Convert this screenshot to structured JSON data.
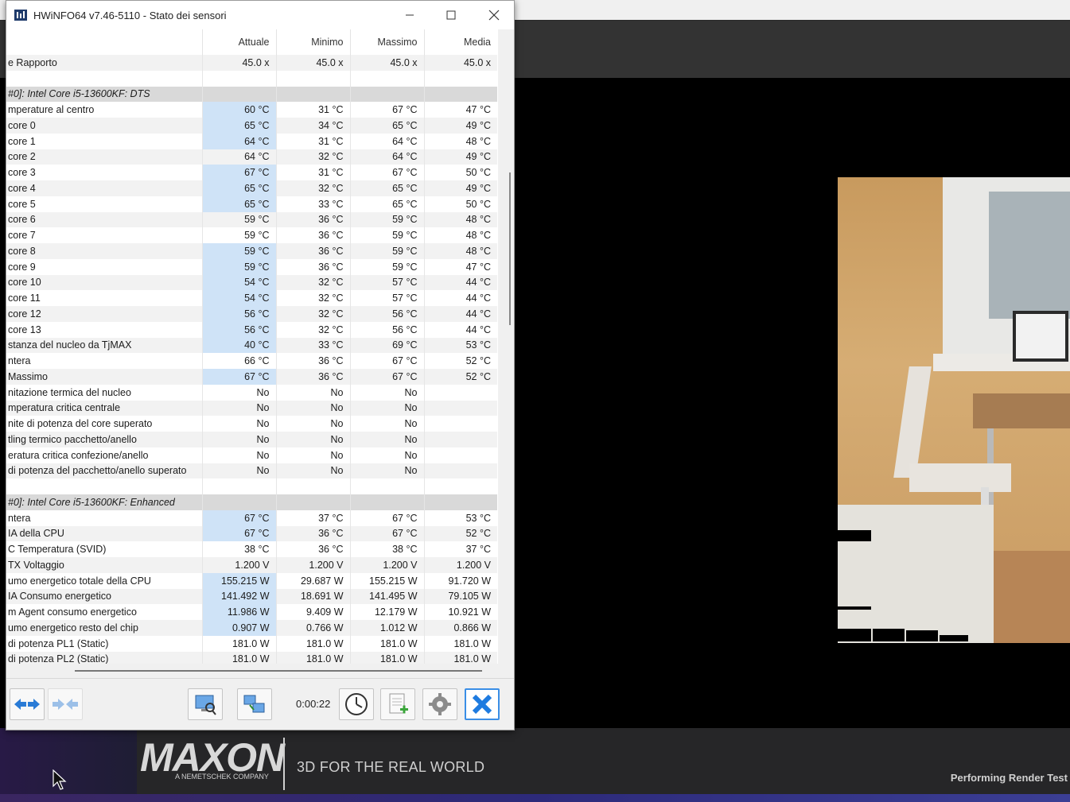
{
  "window": {
    "title": "HWiNFO64 v7.46-5110 - Stato dei sensori",
    "timer": "0:00:22"
  },
  "columns": [
    "",
    "Attuale",
    "Minimo",
    "Massimo",
    "Media"
  ],
  "rows": [
    {
      "type": "data",
      "label": "e Rapporto",
      "cur": "45.0 x",
      "min": "45.0 x",
      "max": "45.0 x",
      "avg": "45.0 x",
      "hl": false
    },
    {
      "type": "blank"
    },
    {
      "type": "section",
      "label": "#0]: Intel Core i5-13600KF: DTS"
    },
    {
      "type": "data",
      "label": "mperature al centro",
      "cur": "60 °C",
      "min": "31 °C",
      "max": "67 °C",
      "avg": "47 °C",
      "hl": true
    },
    {
      "type": "data",
      "label": "core 0",
      "cur": "65 °C",
      "min": "34 °C",
      "max": "65 °C",
      "avg": "49 °C",
      "hl": true
    },
    {
      "type": "data",
      "label": "core 1",
      "cur": "64 °C",
      "min": "31 °C",
      "max": "64 °C",
      "avg": "48 °C",
      "hl": true
    },
    {
      "type": "data",
      "label": "core 2",
      "cur": "64 °C",
      "min": "32 °C",
      "max": "64 °C",
      "avg": "49 °C",
      "hl": false
    },
    {
      "type": "data",
      "label": "core 3",
      "cur": "67 °C",
      "min": "31 °C",
      "max": "67 °C",
      "avg": "50 °C",
      "hl": true
    },
    {
      "type": "data",
      "label": "core 4",
      "cur": "65 °C",
      "min": "32 °C",
      "max": "65 °C",
      "avg": "49 °C",
      "hl": true
    },
    {
      "type": "data",
      "label": "core 5",
      "cur": "65 °C",
      "min": "33 °C",
      "max": "65 °C",
      "avg": "50 °C",
      "hl": true
    },
    {
      "type": "data",
      "label": "core 6",
      "cur": "59 °C",
      "min": "36 °C",
      "max": "59 °C",
      "avg": "48 °C",
      "hl": false
    },
    {
      "type": "data",
      "label": "core 7",
      "cur": "59 °C",
      "min": "36 °C",
      "max": "59 °C",
      "avg": "48 °C",
      "hl": false
    },
    {
      "type": "data",
      "label": "core 8",
      "cur": "59 °C",
      "min": "36 °C",
      "max": "59 °C",
      "avg": "48 °C",
      "hl": true
    },
    {
      "type": "data",
      "label": "core 9",
      "cur": "59 °C",
      "min": "36 °C",
      "max": "59 °C",
      "avg": "47 °C",
      "hl": true
    },
    {
      "type": "data",
      "label": "core 10",
      "cur": "54 °C",
      "min": "32 °C",
      "max": "57 °C",
      "avg": "44 °C",
      "hl": true
    },
    {
      "type": "data",
      "label": "core 11",
      "cur": "54 °C",
      "min": "32 °C",
      "max": "57 °C",
      "avg": "44 °C",
      "hl": true
    },
    {
      "type": "data",
      "label": "core 12",
      "cur": "56 °C",
      "min": "32 °C",
      "max": "56 °C",
      "avg": "44 °C",
      "hl": true
    },
    {
      "type": "data",
      "label": "core 13",
      "cur": "56 °C",
      "min": "32 °C",
      "max": "56 °C",
      "avg": "44 °C",
      "hl": true
    },
    {
      "type": "data",
      "label": "stanza del nucleo da TjMAX",
      "cur": "40 °C",
      "min": "33 °C",
      "max": "69 °C",
      "avg": "53 °C",
      "hl": true
    },
    {
      "type": "data",
      "label": "ntera",
      "cur": "66 °C",
      "min": "36 °C",
      "max": "67 °C",
      "avg": "52 °C",
      "hl": false
    },
    {
      "type": "data",
      "label": "Massimo",
      "cur": "67 °C",
      "min": "36 °C",
      "max": "67 °C",
      "avg": "52 °C",
      "hl": true
    },
    {
      "type": "data",
      "label": "nitazione termica del nucleo",
      "cur": "No",
      "min": "No",
      "max": "No",
      "avg": "",
      "hl": false
    },
    {
      "type": "data",
      "label": "mperatura critica centrale",
      "cur": "No",
      "min": "No",
      "max": "No",
      "avg": "",
      "hl": false
    },
    {
      "type": "data",
      "label": "nite di potenza del core superato",
      "cur": "No",
      "min": "No",
      "max": "No",
      "avg": "",
      "hl": false
    },
    {
      "type": "data",
      "label": "tling termico pacchetto/anello",
      "cur": "No",
      "min": "No",
      "max": "No",
      "avg": "",
      "hl": false
    },
    {
      "type": "data",
      "label": "eratura critica confezione/anello",
      "cur": "No",
      "min": "No",
      "max": "No",
      "avg": "",
      "hl": false
    },
    {
      "type": "data",
      "label": " di potenza del pacchetto/anello superato",
      "cur": "No",
      "min": "No",
      "max": "No",
      "avg": "",
      "hl": false
    },
    {
      "type": "blank"
    },
    {
      "type": "section",
      "label": "#0]: Intel Core i5-13600KF: Enhanced"
    },
    {
      "type": "data",
      "label": "ntera",
      "cur": "67 °C",
      "min": "37 °C",
      "max": "67 °C",
      "avg": "53 °C",
      "hl": true
    },
    {
      "type": "data",
      "label": "IA della CPU",
      "cur": "67 °C",
      "min": "36 °C",
      "max": "67 °C",
      "avg": "52 °C",
      "hl": true
    },
    {
      "type": "data",
      "label": "C Temperatura (SVID)",
      "cur": "38 °C",
      "min": "36 °C",
      "max": "38 °C",
      "avg": "37 °C",
      "hl": false
    },
    {
      "type": "data",
      "label": " TX Voltaggio",
      "cur": "1.200 V",
      "min": "1.200 V",
      "max": "1.200 V",
      "avg": "1.200 V",
      "hl": false
    },
    {
      "type": "data",
      "label": "umo energetico totale della CPU",
      "cur": "155.215 W",
      "min": "29.687 W",
      "max": "155.215 W",
      "avg": "91.720 W",
      "hl": true
    },
    {
      "type": "data",
      "label": "IA Consumo energetico",
      "cur": "141.492 W",
      "min": "18.691 W",
      "max": "141.495 W",
      "avg": "79.105 W",
      "hl": true
    },
    {
      "type": "data",
      "label": "m Agent consumo energetico",
      "cur": "11.986 W",
      "min": "9.409 W",
      "max": "12.179 W",
      "avg": "10.921 W",
      "hl": true
    },
    {
      "type": "data",
      "label": "umo energetico resto del chip",
      "cur": "0.907 W",
      "min": "0.766 W",
      "max": "1.012 W",
      "avg": "0.866 W",
      "hl": true
    },
    {
      "type": "data",
      "label": " di potenza PL1 (Static)",
      "cur": "181.0 W",
      "min": "181.0 W",
      "max": "181.0 W",
      "avg": "181.0 W",
      "hl": false
    },
    {
      "type": "data",
      "label": " di potenza PL2 (Static)",
      "cur": "181.0 W",
      "min": "181.0 W",
      "max": "181.0 W",
      "avg": "181.0 W",
      "hl": false
    }
  ],
  "footer": {
    "brand": "MAXON",
    "brand_sub": "A NEMETSCHEK COMPANY",
    "tagline": "3D FOR THE REAL WORLD",
    "status": "Performing Render Test"
  },
  "colors": {
    "highlight": "#cfe3f7",
    "section": "#d9d9d9",
    "close_accent": "#1e7be0"
  }
}
